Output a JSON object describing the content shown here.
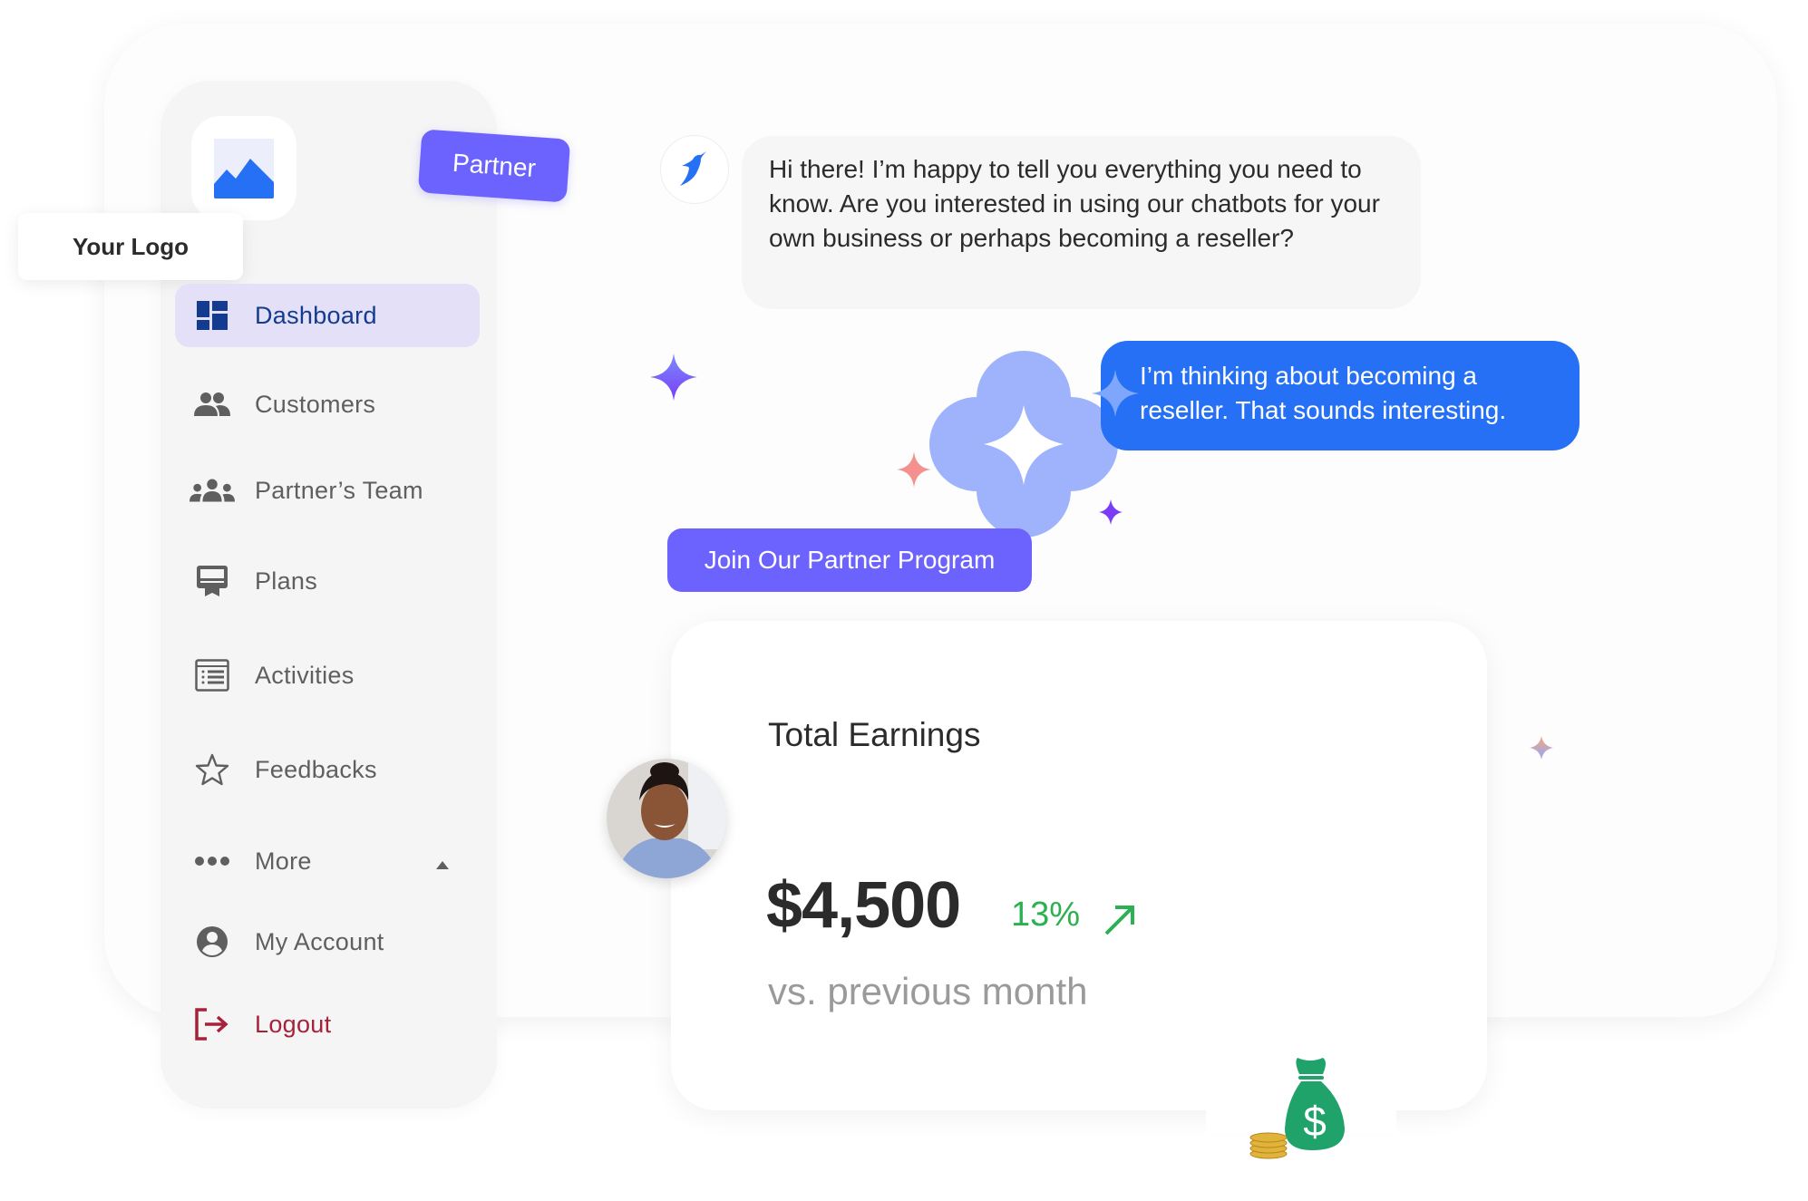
{
  "brand": {
    "logo_label": "Your Logo",
    "logo_icon": "image-placeholder-icon",
    "badge": "Partner"
  },
  "sidebar": {
    "items": [
      {
        "label": "Dashboard",
        "icon": "dashboard-icon",
        "active": true
      },
      {
        "label": "Customers",
        "icon": "people-icon"
      },
      {
        "label": "Partner’s Team",
        "icon": "groups-icon"
      },
      {
        "label": "Plans",
        "icon": "card-membership-icon"
      },
      {
        "label": "Activities",
        "icon": "list-alt-icon"
      },
      {
        "label": "Feedbacks",
        "icon": "star-outline-icon"
      },
      {
        "label": "More",
        "icon": "more-horiz-icon",
        "expand_icon": "caret-up-icon"
      },
      {
        "label": "My Account",
        "icon": "account-circle-icon"
      },
      {
        "label": "Logout",
        "icon": "logout-icon"
      }
    ]
  },
  "chat": {
    "bot_avatar_icon": "bird-logo-icon",
    "bot_message": "Hi there! I’m happy to tell you everything you need to know.  Are you interested in using our chatbots for your own business or perhaps becoming a reseller?",
    "user_message": "I’m thinking about becoming a reseller. That sounds interesting.",
    "cta_button": "Join Our Partner Program"
  },
  "earnings": {
    "title": "Total Earnings",
    "amount": "$4,500",
    "change": "13%",
    "trend_icon": "arrow-up-right-icon",
    "comparison": "vs. previous month"
  },
  "colors": {
    "accent_purple": "#6c63ff",
    "accent_blue": "#2570f4",
    "active_nav_bg": "#e4e0f7",
    "active_nav_text": "#133b8f",
    "logout": "#a8213a",
    "positive": "#2bb052",
    "flower": "#9fb3fd"
  }
}
